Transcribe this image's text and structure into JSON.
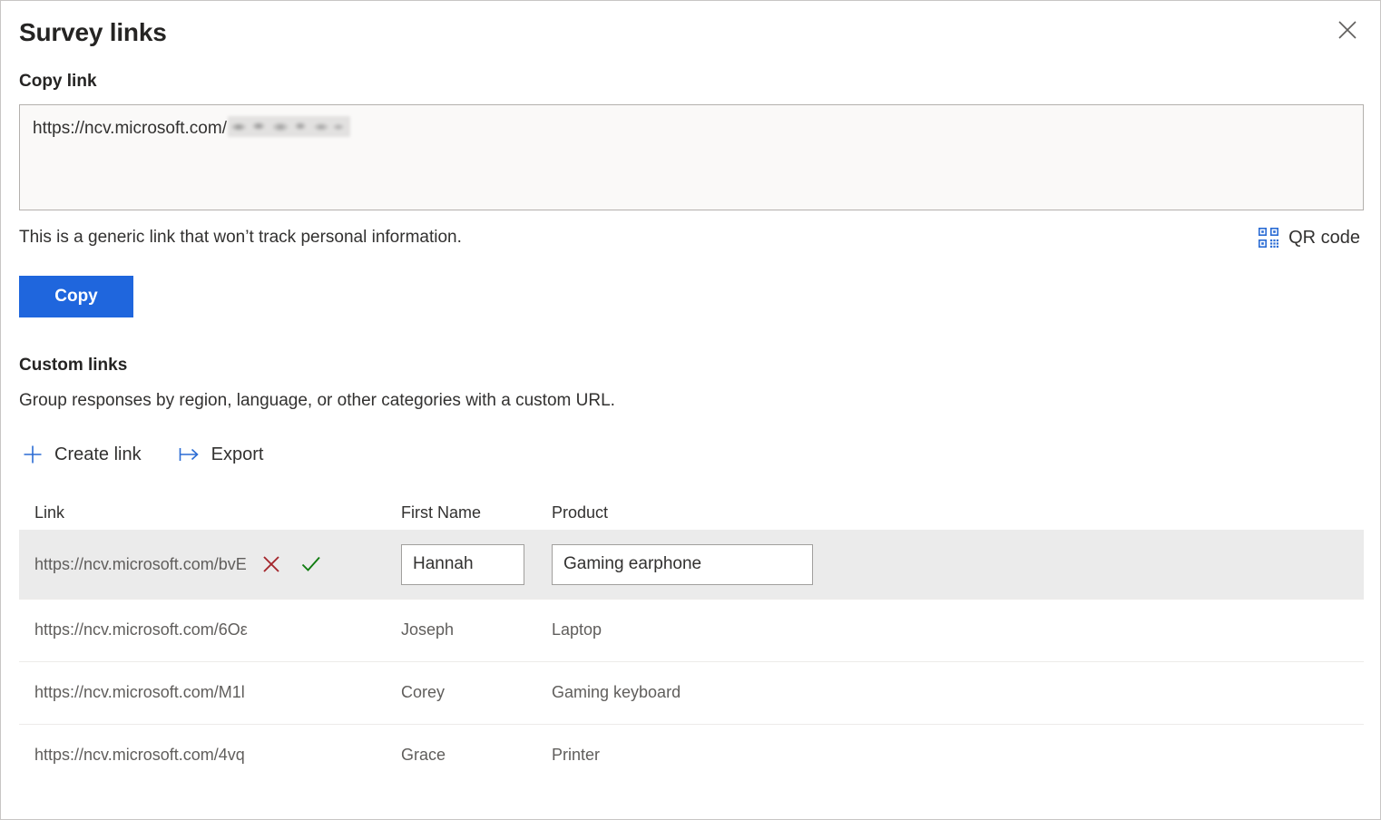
{
  "dialog": {
    "title": "Survey links",
    "close_icon": "close-icon"
  },
  "copy_link": {
    "label": "Copy link",
    "url_prefix": "https://ncv.microsoft.com/",
    "url_suffix_redacted": true,
    "note": "This is a generic link that won’t track personal information.",
    "qr": {
      "label": "QR code",
      "icon": "qr-code-icon"
    },
    "copy_button": "Copy"
  },
  "custom_links": {
    "title": "Custom links",
    "description": "Group responses by region, language, or other categories with a custom URL.",
    "commands": [
      {
        "label": "Create link",
        "icon": "plus-icon"
      },
      {
        "label": "Export",
        "icon": "export-arrow-icon"
      }
    ],
    "table": {
      "columns": [
        "Link",
        "First Name",
        "Product"
      ],
      "rows": [
        {
          "link": "https://ncv.microsoft.com/bvE",
          "first_name": "Hannah",
          "product": "Gaming earphone",
          "selected": true,
          "editing": true,
          "actions": [
            {
              "name": "cancel-edit-icon",
              "glyph": "x",
              "color": "#a4262c"
            },
            {
              "name": "confirm-edit-icon",
              "glyph": "check",
              "color": "#107c10"
            }
          ]
        },
        {
          "link": "https://ncv.microsoft.com/6Oε",
          "first_name": "Joseph",
          "product": "Laptop",
          "selected": false,
          "editing": false
        },
        {
          "link": "https://ncv.microsoft.com/M1l",
          "first_name": "Corey",
          "product": "Gaming keyboard",
          "selected": false,
          "editing": false
        },
        {
          "link": "https://ncv.microsoft.com/4vq",
          "first_name": "Grace",
          "product": "Printer",
          "selected": false,
          "editing": false
        }
      ]
    }
  },
  "colors": {
    "accent_blue": "#1f66dd",
    "icon_blue": "#2b6cd4",
    "selected_row": "#ebebeb",
    "error_red": "#a4262c",
    "success_green": "#107c10",
    "text_primary": "#323130",
    "text_secondary": "#605e5c"
  }
}
